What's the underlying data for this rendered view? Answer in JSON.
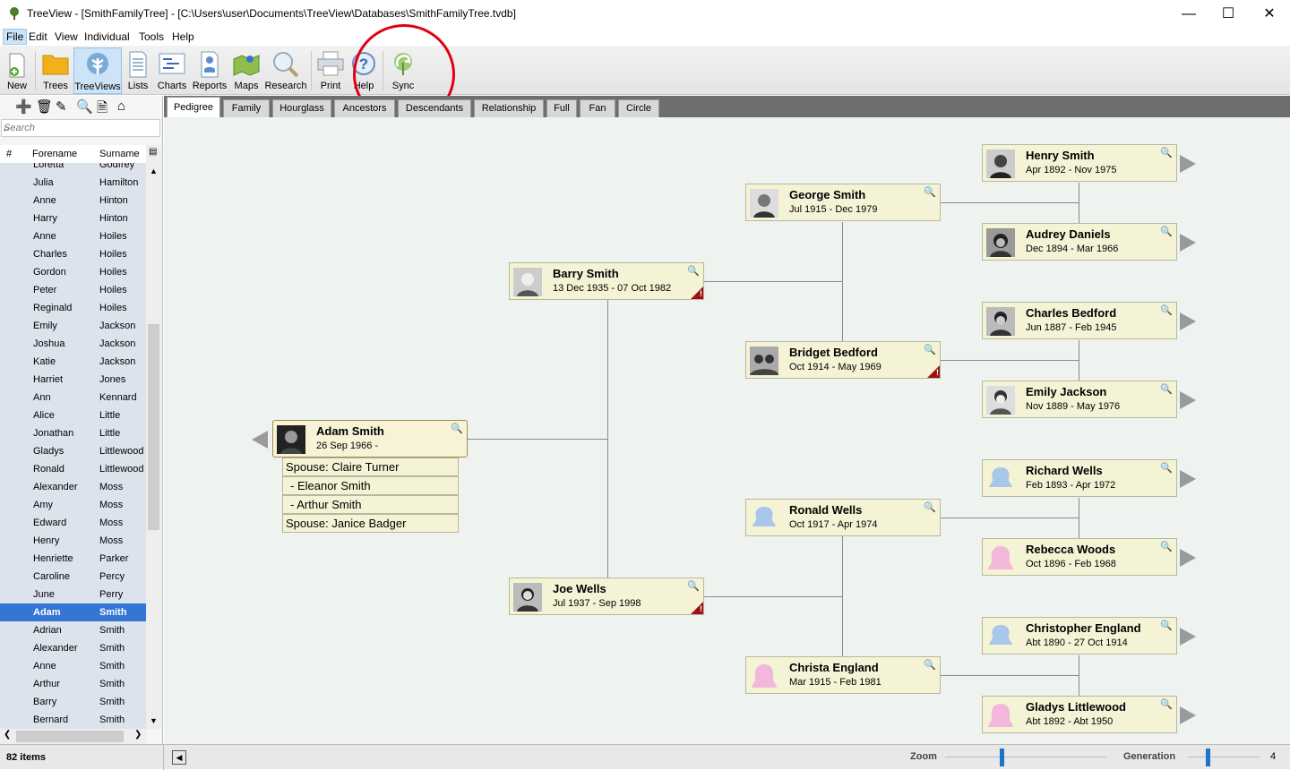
{
  "window": {
    "title": "TreeView - [SmithFamilyTree] - [C:\\Users\\user\\Documents\\TreeView\\Databases\\SmithFamilyTree.tvdb]",
    "minimize": "—",
    "maximize": "☐",
    "close": "✕"
  },
  "menu": [
    "File",
    "Edit",
    "View",
    "Individual",
    "Tools",
    "Help"
  ],
  "toolbar": [
    {
      "label": "New",
      "icon": "new-document-icon"
    },
    {
      "label": "Trees",
      "icon": "folder-icon"
    },
    {
      "label": "TreeViews",
      "icon": "tree-icon"
    },
    {
      "label": "Lists",
      "icon": "list-icon"
    },
    {
      "label": "Charts",
      "icon": "chart-icon"
    },
    {
      "label": "Reports",
      "icon": "report-icon"
    },
    {
      "label": "Maps",
      "icon": "map-icon"
    },
    {
      "label": "Research",
      "icon": "magnifier-icon"
    },
    {
      "label": "Print",
      "icon": "printer-icon"
    },
    {
      "label": "Help",
      "icon": "help-icon"
    },
    {
      "label": "Sync",
      "icon": "sync-icon"
    }
  ],
  "search": {
    "placeholder": "Search"
  },
  "list": {
    "columns": [
      "#",
      "Forename",
      "Surname"
    ],
    "rows": [
      [
        "Loretta",
        "Godfrey"
      ],
      [
        "Julia",
        "Hamilton"
      ],
      [
        "Anne",
        "Hinton"
      ],
      [
        "Harry",
        "Hinton"
      ],
      [
        "Anne",
        "Hoiles"
      ],
      [
        "Charles",
        "Hoiles"
      ],
      [
        "Gordon",
        "Hoiles"
      ],
      [
        "Peter",
        "Hoiles"
      ],
      [
        "Reginald",
        "Hoiles"
      ],
      [
        "Emily",
        "Jackson"
      ],
      [
        "Joshua",
        "Jackson"
      ],
      [
        "Katie",
        "Jackson"
      ],
      [
        "Harriet",
        "Jones"
      ],
      [
        "Ann",
        "Kennard"
      ],
      [
        "Alice",
        "Little"
      ],
      [
        "Jonathan",
        "Little"
      ],
      [
        "Gladys",
        "Littlewood"
      ],
      [
        "Ronald",
        "Littlewood"
      ],
      [
        "Alexander",
        "Moss"
      ],
      [
        "Amy",
        "Moss"
      ],
      [
        "Edward",
        "Moss"
      ],
      [
        "Henry",
        "Moss"
      ],
      [
        "Henriette",
        "Parker"
      ],
      [
        "Caroline",
        "Percy"
      ],
      [
        "June",
        "Perry"
      ],
      [
        "Adam",
        "Smith"
      ],
      [
        "Adrian",
        "Smith"
      ],
      [
        "Alexander",
        "Smith"
      ],
      [
        "Anne",
        "Smith"
      ],
      [
        "Arthur",
        "Smith"
      ],
      [
        "Barry",
        "Smith"
      ],
      [
        "Bernard",
        "Smith"
      ]
    ],
    "selected_index": 25
  },
  "tabs": [
    "Pedigree",
    "Family",
    "Hourglass",
    "Ancestors",
    "Descendants",
    "Relationship",
    "Full",
    "Fan",
    "Circle"
  ],
  "people": {
    "adam": {
      "name": "Adam Smith",
      "dates": "26 Sep 1966 -"
    },
    "barry": {
      "name": "Barry Smith",
      "dates": "13 Dec 1935 - 07 Oct 1982"
    },
    "joe": {
      "name": "Joe Wells",
      "dates": "Jul 1937 - Sep 1998"
    },
    "george": {
      "name": "George Smith",
      "dates": "Jul 1915 - Dec 1979"
    },
    "bridget": {
      "name": "Bridget Bedford",
      "dates": "Oct 1914 - May 1969"
    },
    "ronald": {
      "name": "Ronald Wells",
      "dates": "Oct 1917 - Apr 1974"
    },
    "christa": {
      "name": "Christa England",
      "dates": "Mar 1915 - Feb 1981"
    },
    "henry": {
      "name": "Henry Smith",
      "dates": "Apr 1892 - Nov 1975"
    },
    "audrey": {
      "name": "Audrey Daniels",
      "dates": "Dec 1894 - Mar 1966"
    },
    "charles": {
      "name": "Charles Bedford",
      "dates": "Jun 1887 - Feb 1945"
    },
    "emily": {
      "name": "Emily Jackson",
      "dates": "Nov 1889 - May 1976"
    },
    "richard": {
      "name": "Richard Wells",
      "dates": "Feb 1893 - Apr 1972"
    },
    "rebecca": {
      "name": "Rebecca Woods",
      "dates": "Oct 1896 - Feb 1968"
    },
    "christopher": {
      "name": "Christopher England",
      "dates": "Abt 1890 - 27 Oct 1914"
    },
    "gladys": {
      "name": "Gladys Littlewood",
      "dates": "Abt 1892 - Abt 1950"
    }
  },
  "family_list": [
    "Spouse: Claire Turner",
    " - Eleanor Smith",
    " - Arthur Smith",
    "Spouse: Janice Badger"
  ],
  "warning_mark": "!",
  "status": {
    "count": "82 items",
    "zoom_label": "Zoom",
    "zoom_level": 0.35,
    "generation_label": "Generation",
    "generation_value": "4",
    "generation_level": 0.5
  },
  "colors": {
    "selected_row": "#3575d3",
    "person_box": "#f5f3d5",
    "callout": "#e00010",
    "warning_flag": "#a01010",
    "male_silhouette": "#a9c7ea",
    "female_silhouette": "#f2b8dc"
  }
}
